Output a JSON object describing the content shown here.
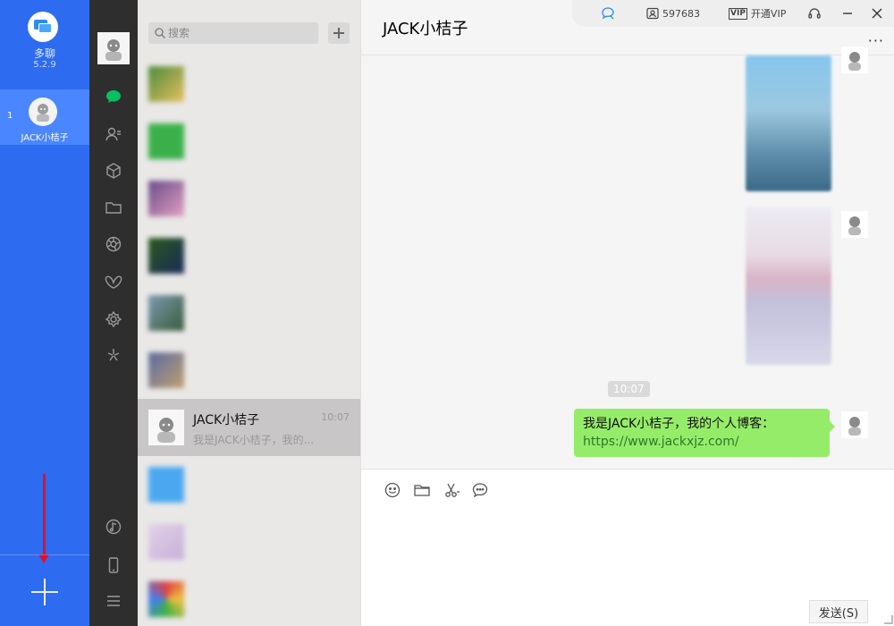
{
  "duoliao": {
    "app_name": "多聊",
    "version": "5.2.9",
    "accounts": [
      {
        "index": "1",
        "name": "JACK小桔子"
      }
    ],
    "icons": {
      "logo": "chat-bubbles-logo-icon",
      "add": "plus-icon",
      "annotation": "red-down-arrow"
    },
    "colors": {
      "rail": "#2d6cf0",
      "active_account": "#4a86ff",
      "arrow": "#e0102c"
    }
  },
  "nav": {
    "icons": [
      "chat-icon",
      "contacts-icon",
      "box-icon",
      "folder-icon",
      "aperture-icon",
      "butterfly-icon",
      "gear-flower-icon",
      "sparkle-icon",
      "music-icon",
      "phone-icon",
      "menu-icon"
    ]
  },
  "search": {
    "placeholder": "搜索"
  },
  "conversations": [
    {
      "name": "",
      "preview": "",
      "time": "",
      "blurred": true
    },
    {
      "name": "",
      "preview": "",
      "time": "",
      "blurred": true
    },
    {
      "name": "",
      "preview": "",
      "time": "",
      "blurred": true
    },
    {
      "name": "",
      "preview": "",
      "time": "",
      "blurred": true
    },
    {
      "name": "",
      "preview": "",
      "time": "",
      "blurred": true
    },
    {
      "name": "",
      "preview": "",
      "time": "",
      "blurred": true
    },
    {
      "name": "JACK小桔子",
      "preview": "我是JACK小桔子，我的...",
      "time": "10:07",
      "active": true
    },
    {
      "name": "",
      "preview": "",
      "time": "",
      "blurred": true
    },
    {
      "name": "",
      "preview": "",
      "time": "",
      "blurred": true
    },
    {
      "name": "",
      "preview": "",
      "time": "",
      "blurred": true
    }
  ],
  "chat": {
    "title": "JACK小桔子",
    "more": "···",
    "timestamp": "10:07",
    "message_text": "我是JACK小桔子，我的个人博客：",
    "message_link": "https://www.jackxjz.com/",
    "send_label": "发送(S)",
    "tools": [
      "emoji-icon",
      "folder-icon",
      "scissors-icon",
      "chat-bubble-icon"
    ],
    "bubble_color": "#95ec69"
  },
  "topbar": {
    "account_id": "597683",
    "vip_label": "开通VIP",
    "vip_badge": "VIP",
    "icons": [
      "cloud-chat-icon",
      "id-card-icon",
      "vip-icon",
      "headset-icon",
      "minimize-icon",
      "close-icon"
    ]
  }
}
